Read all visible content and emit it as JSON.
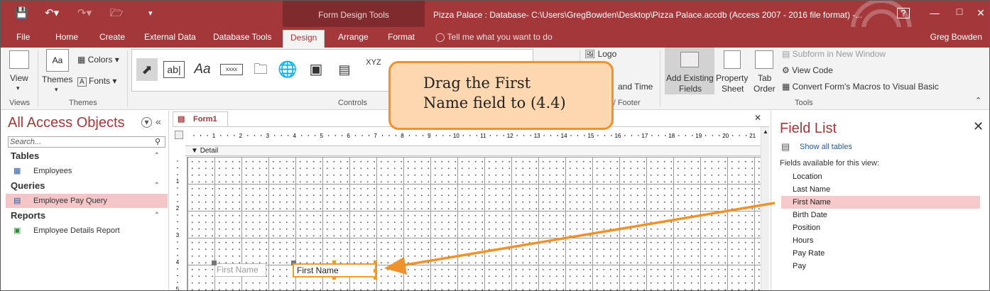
{
  "window": {
    "title": "Pizza Palace : Database- C:\\Users\\GregBowden\\Desktop\\Pizza Palace.accdb (Access 2007 - 2016 file format) -...",
    "context_tab_group": "Form Design Tools",
    "user": "Greg Bowden",
    "help_icon": "?"
  },
  "tabs": [
    "File",
    "Home",
    "Create",
    "External Data",
    "Database Tools",
    "Design",
    "Arrange",
    "Format"
  ],
  "tell_me": "Tell me what you want to do",
  "ribbon": {
    "views": {
      "button": "View",
      "group": "Views"
    },
    "themes": {
      "themes": "Themes",
      "colors": "Colors",
      "fonts": "Fonts",
      "group": "Themes"
    },
    "controls": {
      "group": "Controls",
      "textbox": "ab|",
      "label": "Aa",
      "button_icon": "xxxx",
      "xyz": "XYZ"
    },
    "header_footer": {
      "logo": "Logo",
      "date_time": "and Time",
      "group": "r / Footer"
    },
    "tools": {
      "add_existing_fields_1": "Add Existing",
      "add_existing_fields_2": "Fields",
      "property_sheet_1": "Property",
      "property_sheet_2": "Sheet",
      "tab_order_1": "Tab",
      "tab_order_2": "Order",
      "subform": "Subform in New Window",
      "view_code": "View Code",
      "convert_macros": "Convert Form's Macros to Visual Basic",
      "group": "Tools"
    }
  },
  "nav": {
    "title": "All Access Objects",
    "search_placeholder": "Search...",
    "sections": [
      {
        "name": "Tables",
        "items": [
          "Employees"
        ]
      },
      {
        "name": "Queries",
        "items": [
          "Employee Pay Query"
        ]
      },
      {
        "name": "Reports",
        "items": [
          "Employee Details Report"
        ]
      }
    ],
    "selected_item": "Employee Pay Query"
  },
  "form": {
    "tab_label": "Form1",
    "section_label": "Detail",
    "ruler_h": [
      "1",
      "2",
      "3",
      "4",
      "5",
      "6",
      "7",
      "8",
      "9",
      "10",
      "11",
      "12",
      "13",
      "14",
      "15",
      "16",
      "17",
      "18",
      "19",
      "20",
      "21"
    ],
    "ruler_v": [
      "1",
      "2",
      "3",
      "4",
      "5"
    ],
    "ghost_label": "First Name",
    "textbox_label": "First Name"
  },
  "field_list": {
    "title": "Field List",
    "show_all": "Show all tables",
    "available": "Fields available for this view:",
    "fields": [
      "Location",
      "Last Name",
      "First Name",
      "Birth Date",
      "Position",
      "Hours",
      "Pay Rate",
      "Pay"
    ],
    "selected": "First Name"
  },
  "callout": {
    "line1": "Drag the First",
    "line2": "Name field to (4.4)"
  },
  "colors": {
    "accent": "#a4373a",
    "callout_fill": "#fcd7b0",
    "callout_border": "#f0922b",
    "selection": "#f6c9ca"
  }
}
